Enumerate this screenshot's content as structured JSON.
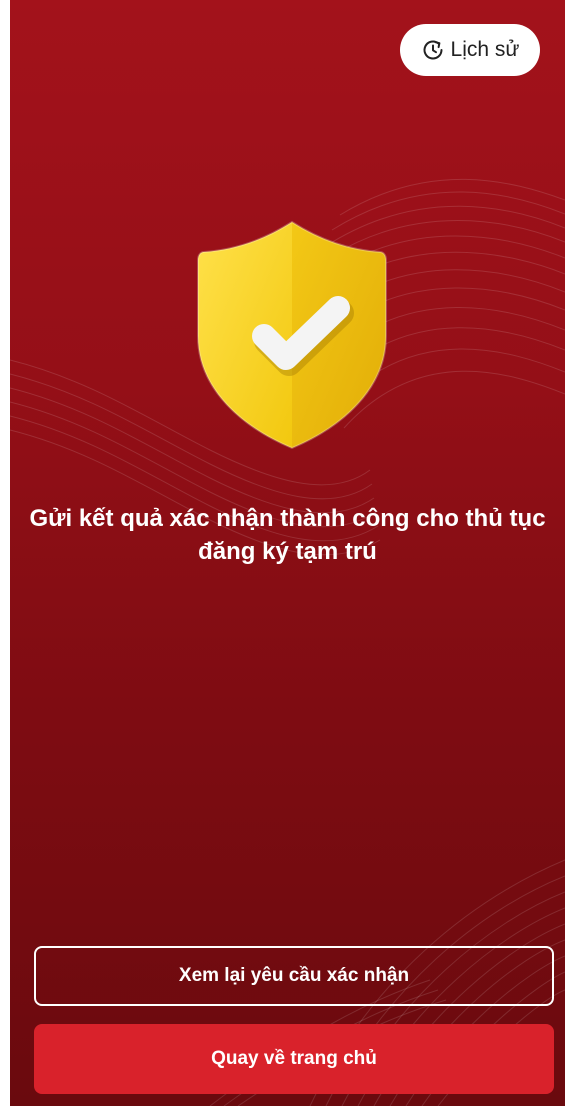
{
  "header": {
    "history_label": "Lịch sử",
    "history_icon": "clock-history-icon"
  },
  "result": {
    "icon": "shield-check-icon",
    "message": "Gửi kết quả xác nhận thành công cho thủ tục đăng ký tạm trú"
  },
  "actions": {
    "review_label": "Xem lại yêu cầu xác nhận",
    "home_label": "Quay về trang chủ"
  },
  "colors": {
    "background_top": "#a3121b",
    "background_bottom": "#6a0a0e",
    "primary_button": "#d9222b",
    "shield_yellow": "#f5d31c"
  }
}
